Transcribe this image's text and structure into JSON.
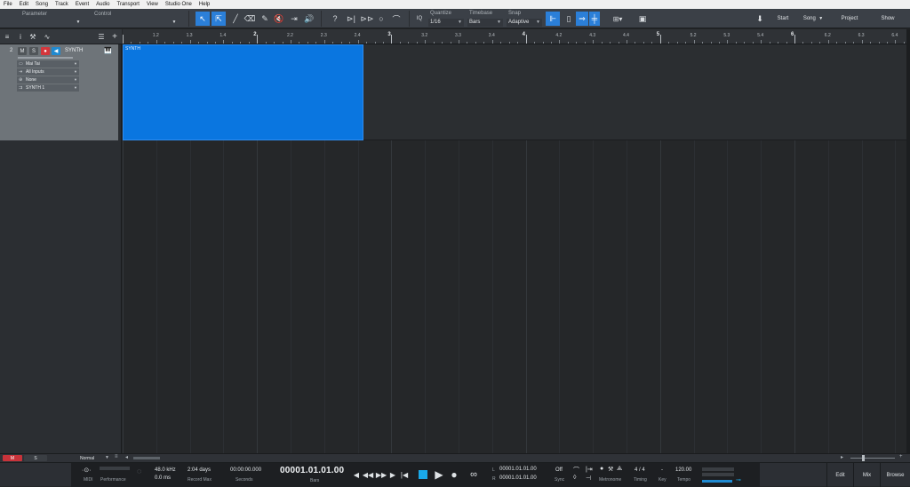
{
  "menubar": [
    "File",
    "Edit",
    "Song",
    "Track",
    "Event",
    "Audio",
    "Transport",
    "View",
    "Studio One",
    "Help"
  ],
  "toolbar": {
    "parameter_label": "Parameter",
    "control_label": "Control",
    "help_label": "?",
    "iq_label": "IQ",
    "quantize_label": "Quantize",
    "quantize_value": "1/16",
    "timebase_label": "Timebase",
    "timebase_value": "Bars",
    "snap_label": "Snap",
    "snap_value": "Adaptive",
    "start_label": "Start",
    "song_label": "Song",
    "project_label": "Project",
    "show_label": "Show",
    "accent_color": "#2b7fd8"
  },
  "track": {
    "number": "2",
    "mute_label": "M",
    "solo_label": "S",
    "name": "SYNTH",
    "instrument": "Mai Tai",
    "input": "All Inputs",
    "channel": "None",
    "output": "SYNTH 1"
  },
  "ruler": [
    {
      "label": "1.2",
      "bar": false
    },
    {
      "label": "1.3",
      "bar": false
    },
    {
      "label": "1.4",
      "bar": false
    },
    {
      "label": "2",
      "bar": true
    },
    {
      "label": "2.2",
      "bar": false
    },
    {
      "label": "2.3",
      "bar": false
    },
    {
      "label": "2.4",
      "bar": false
    },
    {
      "label": "3",
      "bar": true
    },
    {
      "label": "3.2",
      "bar": false
    },
    {
      "label": "3.3",
      "bar": false
    },
    {
      "label": "3.4",
      "bar": false
    },
    {
      "label": "4",
      "bar": true
    },
    {
      "label": "4.2",
      "bar": false
    },
    {
      "label": "4.3",
      "bar": false
    },
    {
      "label": "4.4",
      "bar": false
    },
    {
      "label": "5",
      "bar": true
    },
    {
      "label": "5.2",
      "bar": false
    },
    {
      "label": "5.3",
      "bar": false
    },
    {
      "label": "5.4",
      "bar": false
    },
    {
      "label": "6",
      "bar": true
    },
    {
      "label": "6.2",
      "bar": false
    },
    {
      "label": "6.3",
      "bar": false
    },
    {
      "label": "6.4",
      "bar": false
    }
  ],
  "event": {
    "name": "SYNTH",
    "color": "#0a76e0"
  },
  "bottom": {
    "m_label": "M",
    "s_label": "S",
    "zoom_label": "Normal"
  },
  "transport": {
    "midi_label": "MIDI",
    "performance_label": "Performance",
    "sample_rate": "48.0 kHz",
    "latency": "0.0 ms",
    "record_max_value": "2:04 days",
    "record_max_label": "Record Max",
    "seconds_value": "00:00:00.000",
    "seconds_label": "Seconds",
    "position": "00001.01.01.00",
    "position_unit": "Bars",
    "loop_l_label": "L",
    "loop_l": "00001.01.01.00",
    "loop_r_label": "R",
    "loop_r": "00001.01.01.00",
    "sync_value": "Off",
    "sync_label": "Sync",
    "metronome_label": "Metronome",
    "timing_value": "4 / 4",
    "timing_label": "Timing",
    "key_value": "-",
    "key_label": "Key",
    "tempo_value": "120.00",
    "tempo_label": "Tempo",
    "edit_label": "Edit",
    "mix_label": "Mix",
    "browse_label": "Browse"
  }
}
